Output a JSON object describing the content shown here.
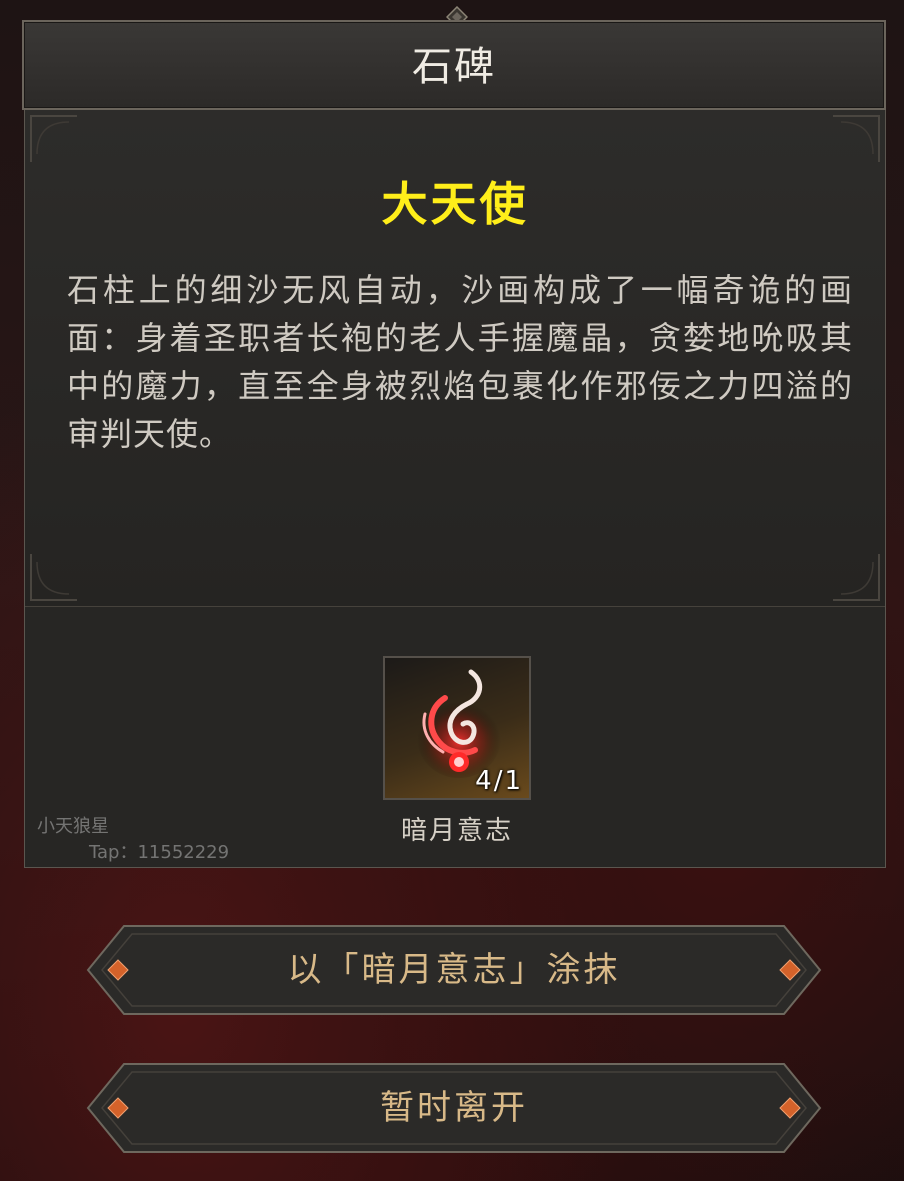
{
  "dialog": {
    "title": "石碑"
  },
  "inscription": {
    "title": "大天使",
    "body": "石柱上的细沙无风自动，沙画构成了一幅奇诡的画面：身着圣职者长袍的老人手握魔晶，贪婪地吮吸其中的魔力，直至全身被烈焰包裹化作邪佞之力四溢的审判天使。",
    "title_color": "#ffee1a"
  },
  "item": {
    "name": "暗月意志",
    "count": "4/1",
    "icon": "red-flame-wisp-icon"
  },
  "watermark": {
    "name": "小天狼星",
    "id": "Tap：11552229"
  },
  "actions": {
    "apply_label": "以「暗月意志」涂抹",
    "leave_label": "暂时离开",
    "label_color": "#d8b988"
  }
}
